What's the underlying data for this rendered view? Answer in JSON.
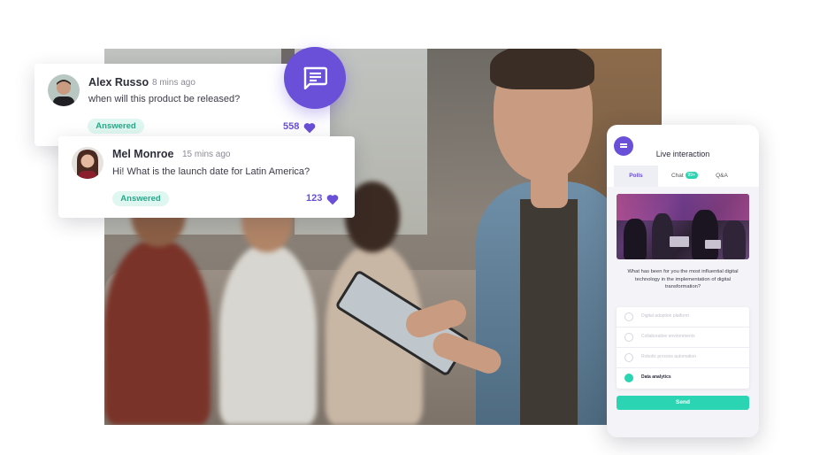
{
  "colors": {
    "accent": "#6a4fd8",
    "teal": "#2bd4b2",
    "badge_bg": "#e0f7f1",
    "badge_text": "#2aa88a"
  },
  "chat_button": {
    "icon": "chat-bubble-icon"
  },
  "comments": [
    {
      "author": "Alex Russo",
      "time": "8 mins ago",
      "message": "when will this product be released?",
      "status": "Answered",
      "likes": "558",
      "like_icon": "heart-icon"
    },
    {
      "author": "Mel Monroe",
      "time": "15 mins ago",
      "message": "Hi! What is the launch date for Latin America?",
      "status": "Answered",
      "likes": "123",
      "like_icon": "heart-icon"
    }
  ],
  "phone": {
    "menu_icon": "menu-icon",
    "title": "Live interaction",
    "tabs": [
      {
        "label": "Polls"
      },
      {
        "label": "Chat",
        "count": "99+"
      },
      {
        "label": "Q&A"
      }
    ],
    "question": "What has been for you the most influential digital technology in the implementation of digital transformation?",
    "options": [
      {
        "label": "Digital adoption platform",
        "selected": false
      },
      {
        "label": "Collaborative environments",
        "selected": false
      },
      {
        "label": "Robotic process automation",
        "selected": false
      },
      {
        "label": "Data analytics",
        "selected": true
      }
    ],
    "send_label": "Send"
  }
}
